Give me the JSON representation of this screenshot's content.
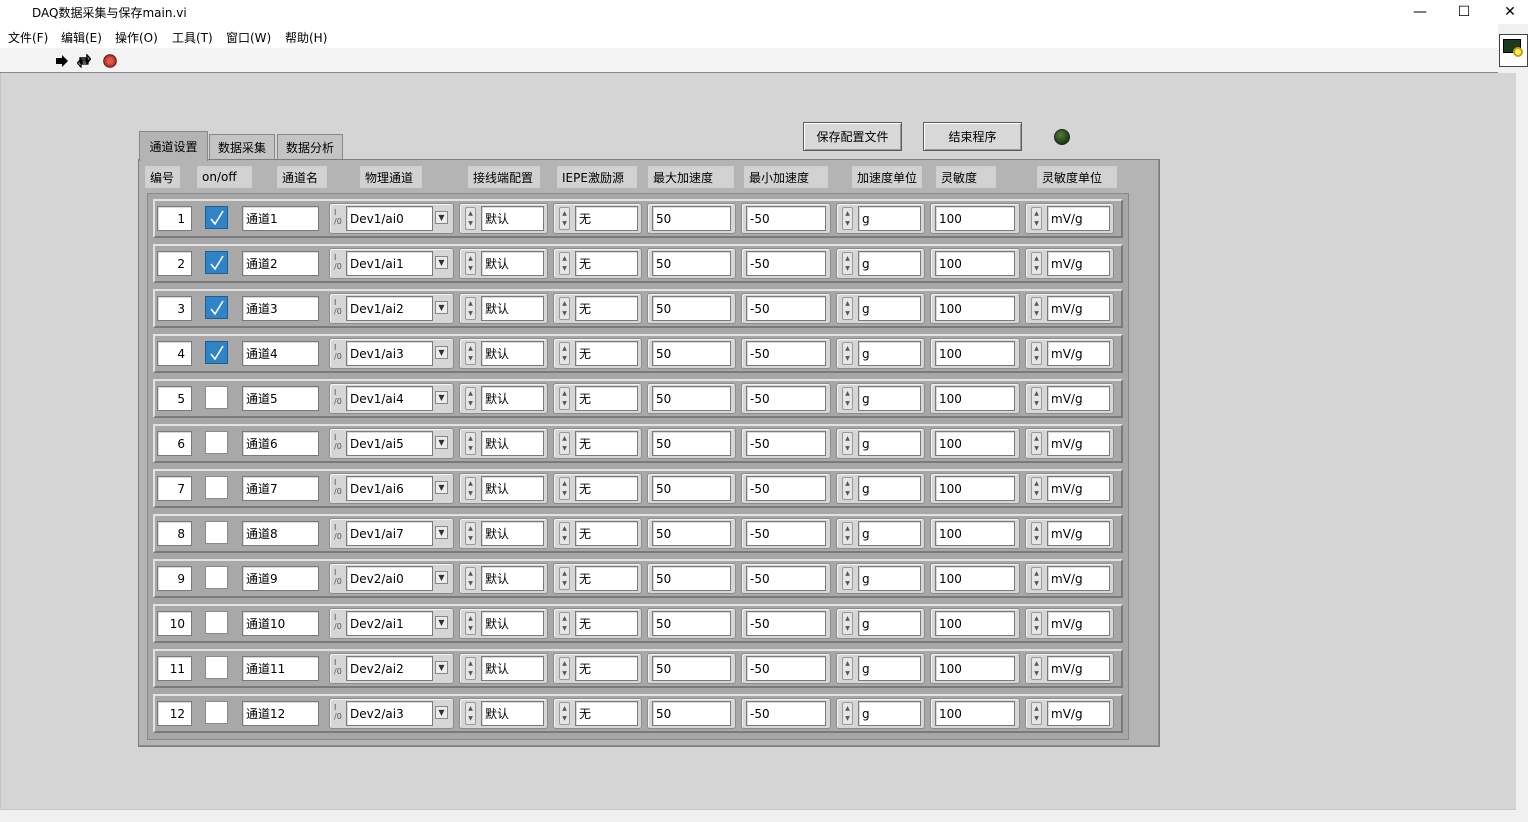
{
  "window": {
    "title": "DAQ数据采集与保存main.vi",
    "minimize": "—",
    "maximize": "☐",
    "close": "✕"
  },
  "menu": [
    "文件(F)",
    "编辑(E)",
    "操作(O)",
    "工具(T)",
    "窗口(W)",
    "帮助(H)"
  ],
  "toolbar": {
    "run_icon": "run-arrow-icon",
    "continuous_icon": "run-continuously-icon",
    "abort_icon": "abort-stop-icon"
  },
  "buttons": {
    "save_config": "保存配置文件",
    "end_program": "结束程序"
  },
  "indicator": {
    "color": "#2a5a1e",
    "state": "off"
  },
  "tabs": [
    {
      "label": "通道设置",
      "active": true
    },
    {
      "label": "数据采集",
      "active": false
    },
    {
      "label": "数据分析",
      "active": false
    }
  ],
  "headers": [
    "编号",
    "on/off",
    "通道名",
    "物理通道",
    "接线端配置",
    "IEPE激励源",
    "最大加速度",
    "最小加速度",
    "加速度单位",
    "灵敏度",
    "灵敏度单位"
  ],
  "rows": [
    {
      "index": "1",
      "on": true,
      "name": "通道1",
      "phys": "Dev1/ai0",
      "term": "默认",
      "iepe": "无",
      "max": "50",
      "min": "-50",
      "unit": "g",
      "sens": "100",
      "sens_unit": "mV/g"
    },
    {
      "index": "2",
      "on": true,
      "name": "通道2",
      "phys": "Dev1/ai1",
      "term": "默认",
      "iepe": "无",
      "max": "50",
      "min": "-50",
      "unit": "g",
      "sens": "100",
      "sens_unit": "mV/g"
    },
    {
      "index": "3",
      "on": true,
      "name": "通道3",
      "phys": "Dev1/ai2",
      "term": "默认",
      "iepe": "无",
      "max": "50",
      "min": "-50",
      "unit": "g",
      "sens": "100",
      "sens_unit": "mV/g"
    },
    {
      "index": "4",
      "on": true,
      "name": "通道4",
      "phys": "Dev1/ai3",
      "term": "默认",
      "iepe": "无",
      "max": "50",
      "min": "-50",
      "unit": "g",
      "sens": "100",
      "sens_unit": "mV/g"
    },
    {
      "index": "5",
      "on": false,
      "name": "通道5",
      "phys": "Dev1/ai4",
      "term": "默认",
      "iepe": "无",
      "max": "50",
      "min": "-50",
      "unit": "g",
      "sens": "100",
      "sens_unit": "mV/g"
    },
    {
      "index": "6",
      "on": false,
      "name": "通道6",
      "phys": "Dev1/ai5",
      "term": "默认",
      "iepe": "无",
      "max": "50",
      "min": "-50",
      "unit": "g",
      "sens": "100",
      "sens_unit": "mV/g"
    },
    {
      "index": "7",
      "on": false,
      "name": "通道7",
      "phys": "Dev1/ai6",
      "term": "默认",
      "iepe": "无",
      "max": "50",
      "min": "-50",
      "unit": "g",
      "sens": "100",
      "sens_unit": "mV/g"
    },
    {
      "index": "8",
      "on": false,
      "name": "通道8",
      "phys": "Dev1/ai7",
      "term": "默认",
      "iepe": "无",
      "max": "50",
      "min": "-50",
      "unit": "g",
      "sens": "100",
      "sens_unit": "mV/g"
    },
    {
      "index": "9",
      "on": false,
      "name": "通道9",
      "phys": "Dev2/ai0",
      "term": "默认",
      "iepe": "无",
      "max": "50",
      "min": "-50",
      "unit": "g",
      "sens": "100",
      "sens_unit": "mV/g"
    },
    {
      "index": "10",
      "on": false,
      "name": "通道10",
      "phys": "Dev2/ai1",
      "term": "默认",
      "iepe": "无",
      "max": "50",
      "min": "-50",
      "unit": "g",
      "sens": "100",
      "sens_unit": "mV/g"
    },
    {
      "index": "11",
      "on": false,
      "name": "通道11",
      "phys": "Dev2/ai2",
      "term": "默认",
      "iepe": "无",
      "max": "50",
      "min": "-50",
      "unit": "g",
      "sens": "100",
      "sens_unit": "mV/g"
    },
    {
      "index": "12",
      "on": false,
      "name": "通道12",
      "phys": "Dev2/ai3",
      "term": "默认",
      "iepe": "无",
      "max": "50",
      "min": "-50",
      "unit": "g",
      "sens": "100",
      "sens_unit": "mV/g"
    }
  ]
}
